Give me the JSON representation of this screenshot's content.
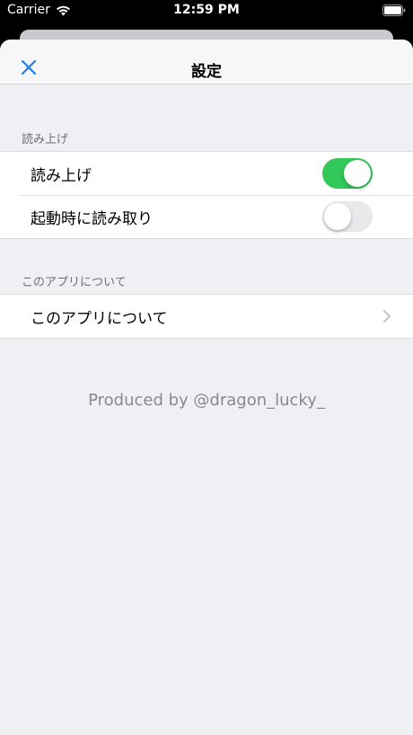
{
  "status_bar": {
    "carrier": "Carrier",
    "time": "12:59 PM",
    "icons": [
      "wifi-icon",
      "battery-icon"
    ]
  },
  "nav": {
    "title": "設定",
    "close_icon": "close-icon",
    "accent_color": "#1a7ef2"
  },
  "sections": [
    {
      "header": "読み上げ",
      "rows": [
        {
          "label": "読み上げ",
          "toggle_on": true
        },
        {
          "label": "起動時に読み取り",
          "toggle_on": false
        }
      ]
    },
    {
      "header": "このアプリについて",
      "rows": [
        {
          "label": "このアプリについて",
          "icon": "chevron-right-icon"
        }
      ]
    }
  ],
  "footer": {
    "text": "Produced by @dragon_lucky_"
  },
  "colors": {
    "toggle_on": "#34c759",
    "toggle_off": "#e9e9eb",
    "background": "#efeff4"
  }
}
